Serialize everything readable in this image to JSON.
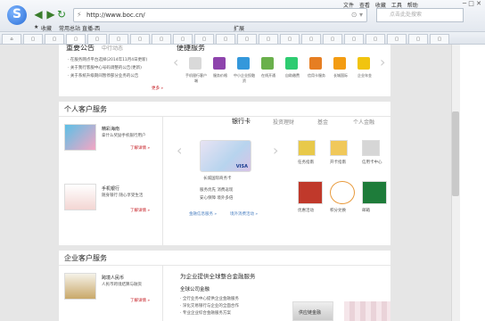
{
  "browser": {
    "url": "http://www.boc.cn/",
    "search_placeholder": "点击此处搜索",
    "menus": [
      "文件",
      "查看",
      "收藏",
      "工具",
      "帮助"
    ],
    "favorites": [
      "收藏",
      "常用总站",
      "直播-西"
    ],
    "extension_label": "扩展"
  },
  "top_section": {
    "notice_title": "重要公告",
    "notice_tab2": "中行动态",
    "notices": [
      "· 在服务网点平台选择(2014年11月4日更新)",
      "· 关于我行客服中心号码调整的公告(更新)",
      "· 关于系统升级期间暂停部分业务的公告"
    ],
    "more": "更多 »",
    "services_title": "便捷服务",
    "services": [
      {
        "label": "手机银行客户端",
        "color": "#d9d9d9"
      },
      {
        "label": "服务价格",
        "color": "#8e44ad"
      },
      {
        "label": "中小企业投融资",
        "color": "#3498db"
      },
      {
        "label": "在线开通",
        "color": "#6ab04c"
      },
      {
        "label": "自助缴费",
        "color": "#2ecc71"
      },
      {
        "label": "信用卡服务",
        "color": "#e67e22"
      },
      {
        "label": "长城国际",
        "color": "#f39c12"
      },
      {
        "label": "企业年金",
        "color": "#f1c40f"
      }
    ]
  },
  "personal": {
    "title": "个人客户服务",
    "promo1": {
      "name": "精彩海南",
      "desc": "拿什么奖励手机银行用户",
      "btn": "了解详情 »",
      "tile": "#6ec7e8"
    },
    "promo2": {
      "name": "手机银行",
      "desc": "随身银行 随心享受生活",
      "btn": "了解详情 »",
      "tile": "#b03a2e"
    },
    "tabs": [
      "银行卡",
      "投资理财",
      "基金",
      "个人金融"
    ],
    "card_name": "长城国际商务卡",
    "card_desc": [
      "服务优先 消费返现",
      "安心保障 境外多倍"
    ],
    "card_links": [
      "金融信息服务 »",
      "境外消费活动 »"
    ],
    "right_icons": [
      {
        "label": "任务指南"
      },
      {
        "label": "开卡指南"
      },
      {
        "label": "信用卡中心"
      },
      {
        "label": "优惠活动"
      },
      {
        "label": "积分兑换"
      },
      {
        "label": "邮箱"
      }
    ]
  },
  "corporate": {
    "title": "企业客户服务",
    "promo": {
      "name": "跨境人民币",
      "desc": "人民币跨境结算与融资",
      "btn": "了解详情 »"
    },
    "headline": "为企业提供全球整合金融服务",
    "sub": "全球公司金融",
    "lines": [
      "· 全行业务中心提供企业金融服务",
      "· 深化交易银行与企业的全面合作",
      "· 专业企业综合金融服务方案"
    ],
    "supply_chain": "供应链金融"
  }
}
